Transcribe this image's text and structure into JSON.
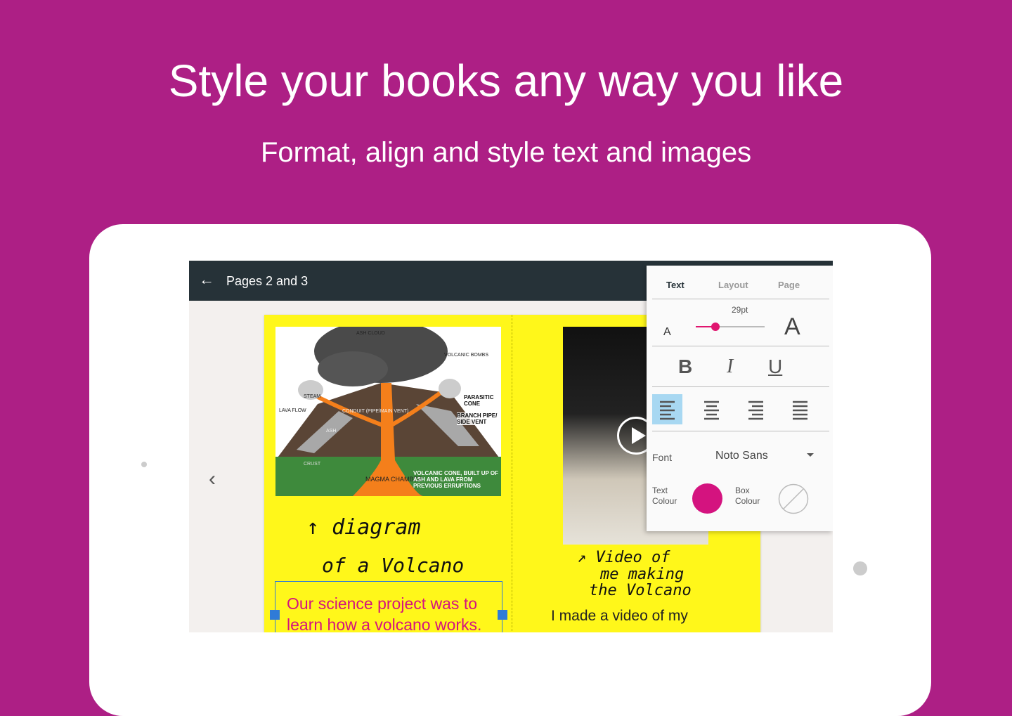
{
  "headline": "Style your books any way you like",
  "subheadline": "Format, align and style text and images",
  "toolbar": {
    "back_icon": "arrow-left-icon",
    "title": "Pages 2 and 3"
  },
  "left_page": {
    "diagram_labels": {
      "ash_cloud": "ASH CLOUD",
      "volcanic_bombs": "VOLCANIC BOMBS",
      "steam": "STEAM",
      "lava_flow": "LAVA FLOW",
      "conduit": "CONDUIT (PIPE/MAIN VENT)",
      "parasitic_cone": "PARASITIC CONE",
      "branch_pipe": "BRANCH PIPE/ SIDE VENT",
      "ash": "ASH",
      "crust": "CRUST",
      "magma_chamber": "MAGMA CHAMBER",
      "volcanic_cone": "VOLCANIC CONE, BUILT UP OF ASH AND LAVA FROM PREVIOUS ERRUPTIONS"
    },
    "handwriting_1": "↑ diagram",
    "handwriting_2": "of a Volcano",
    "text_box": "Our science project was to learn how a volcano works."
  },
  "right_page": {
    "handwriting_1": "↗ Video of",
    "handwriting_2": "me making",
    "handwriting_3": "the Volcano",
    "text": "I made a video of my"
  },
  "panel": {
    "tabs": [
      {
        "label": "Text",
        "active": true
      },
      {
        "label": "Layout"
      },
      {
        "label": "Page"
      }
    ],
    "size_label": "29pt",
    "size_fraction": 0.29,
    "small_a": "A",
    "large_a": "A",
    "bold": "B",
    "italic": "I",
    "underline": "U",
    "align_selected": "left",
    "font_label": "Font",
    "font_value": "Noto Sans",
    "text_colour_label": "Text Colour",
    "text_colour": "#d4137f",
    "box_colour_label": "Box Colour",
    "box_colour": "none"
  }
}
